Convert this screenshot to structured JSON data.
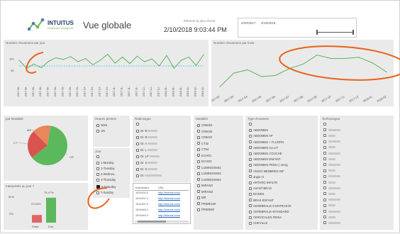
{
  "header": {
    "brand": "INTUITUS",
    "tagline": "Healthcare Intelligence",
    "title": "Vue globale",
    "latest_label": "Élément le plus récent",
    "latest_value": "2/10/2018 9:03:44 PM",
    "date_from": "2/20/2017",
    "date_to": "2/15/2018"
  },
  "charts": {
    "daily_title": "Nombre d'examens par jour",
    "daily_ytick_top": "100",
    "daily_ytick_mid": "50",
    "daily_xlabels": [
      "2017-08-..",
      "2017-08-..",
      "2017-08-..",
      "2017-08-..",
      "2017-08-..",
      "2017-09-..",
      "2017-09-..",
      "2017-09-..",
      "2017-09-..",
      "2017-10-..",
      "2017-10-..",
      "2017-10-..",
      "2017-10-..",
      "2017-11-..",
      "2017-11-..",
      "2017-11-..",
      "2017-11-..",
      "2017-12-..",
      "2017-12-..",
      "2017-12-..",
      "2018-01-..",
      "2018-01-..",
      "2018-01-..",
      "2018-02-..",
      "2018-02-..",
      "2018-02-.."
    ],
    "monthly_title": "Nombre d'examens par mois",
    "monthly_xlabels": [
      "2017-02",
      "2017-03",
      "2017-04",
      "2017-05",
      "2017-06",
      "2017-07",
      "2017-08",
      "2017-09",
      "2017-10",
      "2017-11",
      "2017-12",
      "2018-01",
      "2018-02"
    ],
    "modality_title": "par Modalité",
    "pie_labels": [
      "MR",
      "CT",
      "CR"
    ],
    "urgent_title": "Interprétés au jour ?",
    "bar_labels": [
      "False",
      "True"
    ],
    "bar_values_text": [
      "23.53%",
      "76.47%"
    ],
    "bar_ytick_top": "50%",
    "bar_ytick_bottom": "0%"
  },
  "chart_data": [
    {
      "type": "line",
      "title": "Nombre d'examens par jour",
      "x": [
        "2017-08-..",
        "2017-08-..",
        "2017-08-..",
        "2017-08-..",
        "2017-08-..",
        "2017-09-..",
        "2017-09-..",
        "2017-09-..",
        "2017-09-..",
        "2017-10-..",
        "2017-10-..",
        "2017-10-..",
        "2017-10-..",
        "2017-11-..",
        "2017-11-..",
        "2017-11-..",
        "2017-11-..",
        "2017-12-..",
        "2017-12-..",
        "2017-12-..",
        "2018-01-..",
        "2018-01-..",
        "2018-01-..",
        "2018-02-..",
        "2018-02-..",
        "2018-02-.."
      ],
      "values": [
        95,
        60,
        78,
        62,
        90,
        105,
        98,
        110,
        88,
        102,
        75,
        95,
        120,
        82,
        108,
        80,
        112,
        88,
        100,
        70,
        115,
        60,
        95,
        108,
        72,
        118
      ],
      "reference_value": 70,
      "ylim": [
        0,
        140
      ]
    },
    {
      "type": "line",
      "title": "Nombre d'examens par mois",
      "categories": [
        "2017-02",
        "2017-03",
        "2017-04",
        "2017-05",
        "2017-06",
        "2017-07",
        "2017-08",
        "2017-09",
        "2017-10",
        "2017-11",
        "2017-12",
        "2018-01",
        "2018-02"
      ],
      "values": [
        1300,
        1900,
        2050,
        1750,
        1800,
        2100,
        2300,
        2700,
        2550,
        2550,
        2600,
        2350,
        1950
      ],
      "ylim": [
        1000,
        3000
      ]
    },
    {
      "type": "pie",
      "title": "par Modalité",
      "categories": [
        "CR",
        "MR",
        "CT"
      ],
      "values": [
        62,
        23,
        15
      ]
    },
    {
      "type": "bar",
      "title": "Interprétés au jour ?",
      "categories": [
        "False",
        "True"
      ],
      "values": [
        23.53,
        76.47
      ],
      "ylim": [
        0,
        100
      ]
    }
  ],
  "filters": {
    "urgence_title": "Heures pleines",
    "urgence_items": [
      "NON",
      "UN"
    ],
    "jour_title": "Jour",
    "jour_items": [
      "1-Monday",
      "2-Tuesday",
      "3-Wednes..",
      "4-Thursday",
      "6-Saturday",
      "7-Sunday"
    ],
    "radiologue_title": "Radiologue",
    "radiologue_items": [
      "Dr. B",
      "Dr. B",
      "Dr. A",
      "Dr. L",
      "Dr. LP",
      "Dr. S",
      "Dr. S",
      "Dr."
    ],
    "modalite_title": "Modalité",
    "modalite_items": [
      "CR6003",
      "CR6020",
      "CR6022",
      "CT32",
      "CT64",
      "ECHO1",
      "ECHO2",
      "LUMINOSMS2",
      "LUMINOSMS3",
      "LUMINOSMS4",
      "MIRAM1",
      "MIRAM2",
      "MR",
      "PRIME160",
      "PRIME80"
    ],
    "type_title": "Type d'examen",
    "type_items": [
      "",
      "ABDOMEN",
      "ABDOMEN AP",
      "ABDOMEN + FLUORO",
      "ABDOMEN AU LIT",
      "ABDOMEN COUCHE",
      "ABDOMEN ENFANT",
      "ABDOMEN PEDIA ( 15 kg",
      "ANGIO MEMBRES INF",
      "angio-ct",
      "ARTHRO INFILTR",
      "AVANT-BRAS",
      "BASSIN",
      "BRAS ENFANT",
      "CEREBRALE+CONTRASTE",
      "CEREBRALE+STANDARD",
      "CERVICALES PEDIA",
      "CHEVILLE"
    ],
    "tech_title": "Technologue"
  },
  "table": {
    "col1": "examindex",
    "col2": "URL",
    "rows": [
      [
        "1514433-2",
        "http://telemis.evar/"
      ],
      [
        "1514437-1",
        "http://telemis.evar/"
      ],
      [
        "1514437-2",
        "http://telemis.evar/"
      ],
      [
        "1514449-1",
        "http://telemis.evar/"
      ],
      [
        "1514449-2",
        "http://telemis.evar/"
      ]
    ]
  },
  "colors": {
    "line_green": "#4caf50",
    "ref_teal": "#26c6da",
    "annotation_orange": "#e8621c",
    "pie_green": "#5cb85c",
    "pie_red": "#d9534f",
    "pie_orange": "#e8865c"
  }
}
